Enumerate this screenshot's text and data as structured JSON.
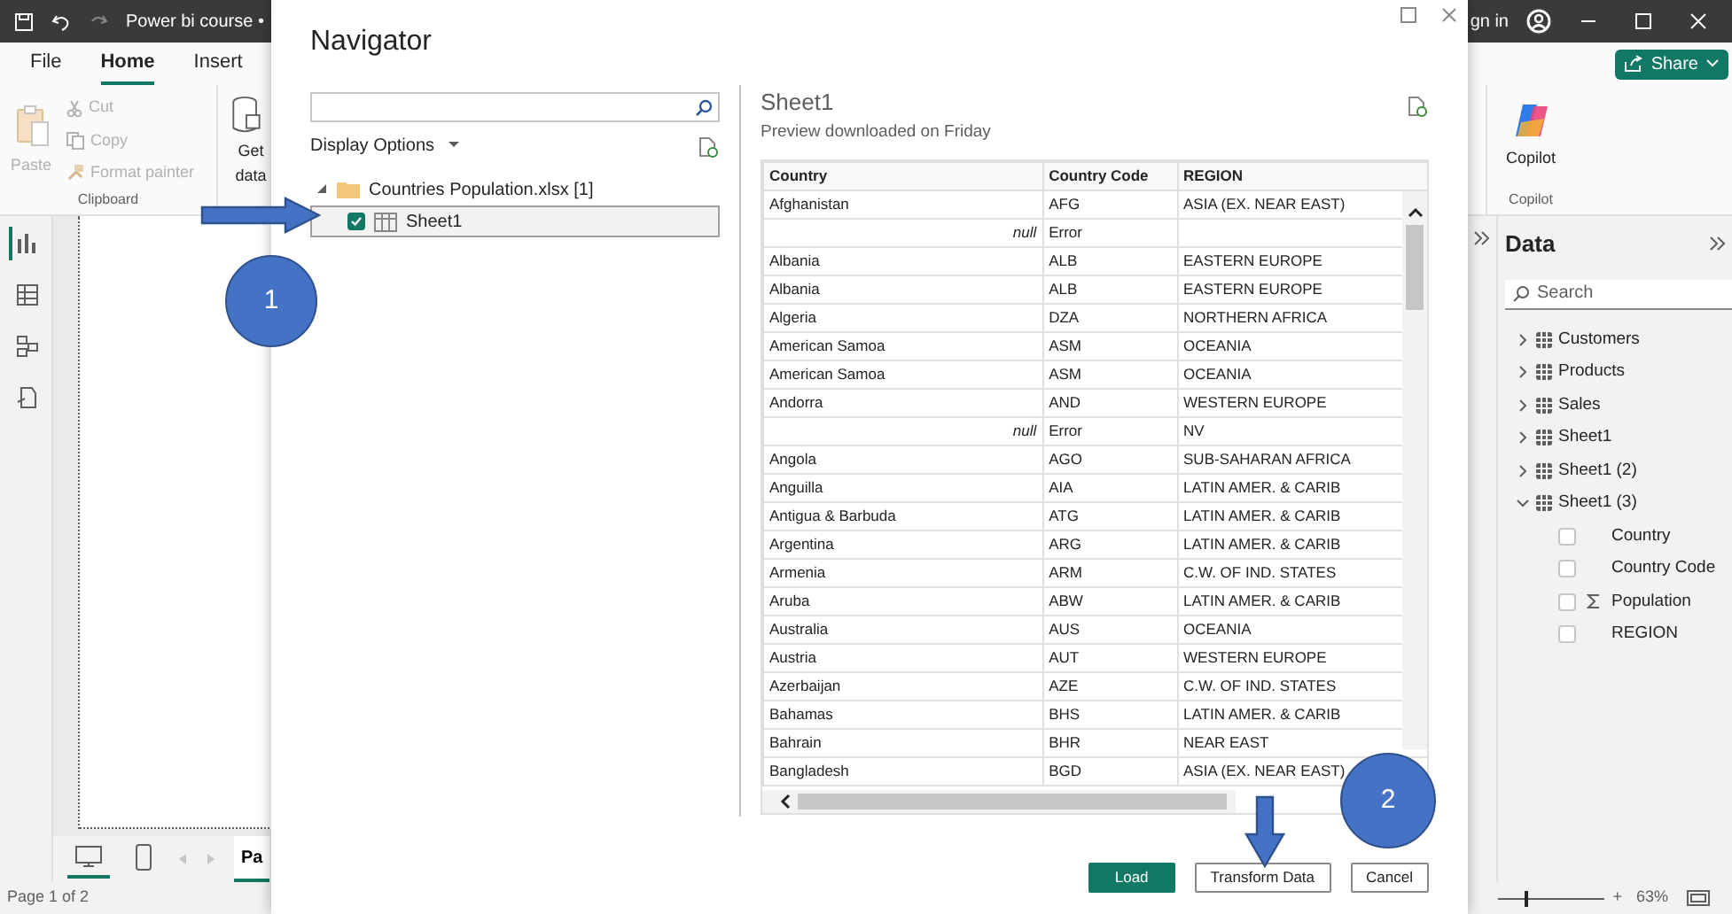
{
  "app": {
    "title": "Power bi course •",
    "account": "gn in",
    "menu_tabs": [
      {
        "label": "File",
        "selected": false
      },
      {
        "label": "Home",
        "selected": true
      },
      {
        "label": "Insert",
        "selected": false
      }
    ],
    "share": "Share",
    "clipboard": {
      "group": "Clipboard",
      "commands": [
        {
          "label": "Paste",
          "kind": "large",
          "disabled": true
        },
        {
          "label": "Cut",
          "kind": "cut",
          "disabled": true
        },
        {
          "label": "Copy",
          "kind": "copy",
          "disabled": true
        },
        {
          "label": "Format painter",
          "kind": "painter",
          "disabled": true
        }
      ]
    },
    "get_data": "Get data",
    "copilot": {
      "label": "Copilot",
      "group": "Copilot"
    },
    "left_nav": [
      {
        "kind": "report",
        "selected": true
      },
      {
        "kind": "table",
        "selected": false
      },
      {
        "kind": "model",
        "selected": false
      },
      {
        "kind": "dax",
        "selected": false
      }
    ],
    "views": [
      {
        "kind": "desktop",
        "selected": true
      },
      {
        "kind": "phone",
        "selected": false
      }
    ],
    "page_tabs": [
      {
        "label": "Pa",
        "selected": true
      }
    ],
    "status": "Page 1 of 2",
    "zoom": {
      "plus": "+",
      "reading": "63%",
      "level": 0.25
    }
  },
  "data_pane": {
    "title": "Data",
    "search_placeholder": "Search",
    "tables": [
      {
        "label": "Customers",
        "expanded": false
      },
      {
        "label": "Products",
        "expanded": false
      },
      {
        "label": "Sales",
        "expanded": false
      },
      {
        "label": "Sheet1",
        "expanded": false
      },
      {
        "label": "Sheet1 (2)",
        "expanded": false
      },
      {
        "label": "Sheet1 (3)",
        "expanded": true,
        "fields": [
          {
            "label": "Country",
            "kind": "text",
            "checked": false
          },
          {
            "label": "Country Code",
            "kind": "text",
            "checked": false
          },
          {
            "label": "Population",
            "kind": "sum",
            "checked": false
          },
          {
            "label": "REGION",
            "kind": "text",
            "checked": false
          }
        ]
      }
    ]
  },
  "navigator": {
    "title": "Navigator",
    "display_options": "Display Options",
    "tree": [
      {
        "label": "Countries Population.xlsx [1]",
        "expanded": true,
        "children": [
          {
            "label": "Sheet1",
            "checked": true,
            "selected": true
          }
        ]
      }
    ],
    "preview": {
      "title": "Sheet1",
      "subtitle": "Preview downloaded on Friday",
      "columns": [
        "Country",
        "Country Code",
        "REGION"
      ],
      "rows": [
        {
          "kind": "data",
          "cells": [
            "Afghanistan",
            "AFG",
            "ASIA (EX. NEAR EAST)"
          ]
        },
        {
          "kind": "error",
          "cells": [
            "null",
            "Error"
          ]
        },
        {
          "kind": "data",
          "cells": [
            "Albania",
            "ALB",
            "EASTERN EUROPE"
          ]
        },
        {
          "kind": "data",
          "cells": [
            "Albania",
            "ALB",
            "EASTERN EUROPE"
          ]
        },
        {
          "kind": "data",
          "cells": [
            "Algeria",
            "DZA",
            "NORTHERN AFRICA"
          ]
        },
        {
          "kind": "data",
          "cells": [
            "American Samoa",
            "ASM",
            "OCEANIA"
          ]
        },
        {
          "kind": "data",
          "cells": [
            "American Samoa",
            "ASM",
            "OCEANIA"
          ]
        },
        {
          "kind": "data",
          "cells": [
            "Andorra",
            "AND",
            "WESTERN EUROPE"
          ]
        },
        {
          "kind": "error",
          "cells": [
            "null",
            "Error",
            "NV"
          ]
        },
        {
          "kind": "data",
          "cells": [
            "Angola",
            "AGO",
            "SUB-SAHARAN AFRICA"
          ]
        },
        {
          "kind": "data",
          "cells": [
            "Anguilla",
            "AIA",
            "LATIN AMER. & CARIB"
          ]
        },
        {
          "kind": "data",
          "cells": [
            "Antigua & Barbuda",
            "ATG",
            "LATIN AMER. & CARIB"
          ]
        },
        {
          "kind": "data",
          "cells": [
            "Argentina",
            "ARG",
            "LATIN AMER. & CARIB"
          ]
        },
        {
          "kind": "data",
          "cells": [
            "Armenia",
            "ARM",
            "C.W. OF IND. STATES"
          ]
        },
        {
          "kind": "data",
          "cells": [
            "Aruba",
            "ABW",
            "LATIN AMER. & CARIB"
          ]
        },
        {
          "kind": "data",
          "cells": [
            "Australia",
            "AUS",
            "OCEANIA"
          ]
        },
        {
          "kind": "data",
          "cells": [
            "Austria",
            "AUT",
            "WESTERN EUROPE"
          ]
        },
        {
          "kind": "data",
          "cells": [
            "Azerbaijan",
            "AZE",
            "C.W. OF IND. STATES"
          ]
        },
        {
          "kind": "data",
          "cells": [
            "Bahamas",
            "BHS",
            "LATIN AMER. & CARIB"
          ]
        },
        {
          "kind": "data",
          "cells": [
            "Bahrain",
            "BHR",
            "NEAR EAST"
          ]
        },
        {
          "kind": "data",
          "cells": [
            "Bangladesh",
            "BGD",
            "ASIA (EX. NEAR EAST)"
          ]
        }
      ]
    },
    "buttons": [
      {
        "label": "Load",
        "kind": "primary"
      },
      {
        "label": "Transform Data",
        "kind": "secondary"
      },
      {
        "label": "Cancel",
        "kind": "secondary"
      }
    ]
  },
  "markers": [
    {
      "label": "1"
    },
    {
      "label": "2"
    }
  ]
}
